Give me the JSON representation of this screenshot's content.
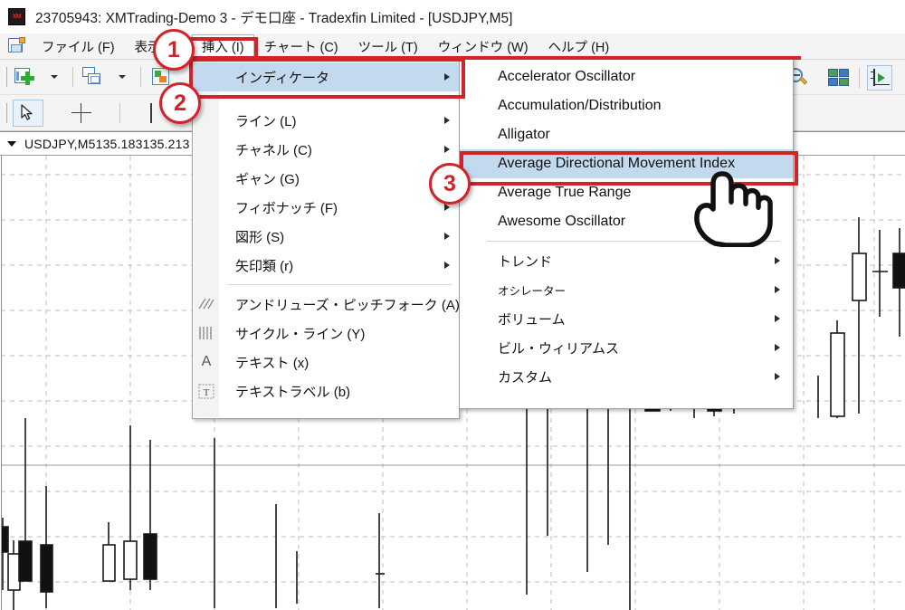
{
  "window": {
    "logo_text": "XM",
    "title": "23705943: XMTrading-Demo 3 - デモ口座 - Tradexfin Limited - [USDJPY,M5]"
  },
  "menubar": {
    "app_icon": "chart-document-icon",
    "items": [
      {
        "label": "ファイル (F)",
        "active": false
      },
      {
        "label": "表示 (V)",
        "active": false
      },
      {
        "label": "挿入 (I)",
        "active": true
      },
      {
        "label": "チャート (C)",
        "active": false
      },
      {
        "label": "ツール (T)",
        "active": false
      },
      {
        "label": "ウィンドウ (W)",
        "active": false
      },
      {
        "label": "ヘルプ (H)",
        "active": false
      }
    ]
  },
  "toolbar_standard": {
    "buttons": [
      {
        "name": "new-chart-button",
        "icon": "new-chart-icon",
        "has_dropdown": true
      },
      {
        "name": "profiles-button",
        "icon": "profiles-icon",
        "has_dropdown": true
      },
      {
        "name": "indicators-button",
        "icon": "indicators-icon",
        "has_dropdown": false
      },
      {
        "name": "crosshair-target-button",
        "icon": "crosshair-target-icon",
        "has_dropdown": false
      },
      {
        "name": "zoom-out-button",
        "icon": "zoom-out-icon",
        "has_dropdown": false
      },
      {
        "name": "tile-windows-button",
        "icon": "tile-windows-icon",
        "has_dropdown": false
      },
      {
        "name": "auto-scroll-button",
        "icon": "axis-play-icon",
        "has_dropdown": false
      }
    ]
  },
  "toolbar_line_studies": {
    "buttons": [
      {
        "name": "cursor-button",
        "icon": "arrow-cursor-icon",
        "pressed": true
      },
      {
        "name": "crosshair-button",
        "icon": "crosshair-icon",
        "pressed": false
      },
      {
        "name": "vertical-line-button",
        "icon": "vertical-line-icon",
        "pressed": false
      },
      {
        "name": "horizontal-line-button",
        "icon": "horizontal-line-icon",
        "pressed": false
      }
    ]
  },
  "chart": {
    "symbol_label": "USDJPY,M5",
    "bid": "135.183",
    "ask": "135.213",
    "chart_data": {
      "type": "candlestick",
      "symbol": "USDJPY",
      "timeframe": "M5",
      "bid": 135.183,
      "ask": 135.213,
      "grid": true
    }
  },
  "insert_menu": {
    "items": [
      {
        "label": "インディケータ",
        "submenu": true,
        "selected": true,
        "icon": ""
      },
      {
        "label": "ライン (L)",
        "submenu": true,
        "selected": false,
        "icon": ""
      },
      {
        "label": "チャネル (C)",
        "submenu": true,
        "selected": false,
        "icon": ""
      },
      {
        "label": "ギャン (G)",
        "submenu": true,
        "selected": false,
        "icon": ""
      },
      {
        "label": "フィボナッチ (F)",
        "submenu": true,
        "selected": false,
        "icon": ""
      },
      {
        "label": "図形 (S)",
        "submenu": true,
        "selected": false,
        "icon": ""
      },
      {
        "label": "矢印類 (r)",
        "submenu": true,
        "selected": false,
        "icon": ""
      },
      {
        "label": "アンドリューズ・ピッチフォーク (A)",
        "submenu": false,
        "selected": false,
        "icon": "pitchfork-icon"
      },
      {
        "label": "サイクル・ライン (Y)",
        "submenu": false,
        "selected": false,
        "icon": "cycle-lines-icon"
      },
      {
        "label": "テキスト (x)",
        "submenu": false,
        "selected": false,
        "icon": "text-icon"
      },
      {
        "label": "テキストラベル (b)",
        "submenu": false,
        "selected": false,
        "icon": "text-label-icon"
      }
    ]
  },
  "indicator_submenu": {
    "items": [
      {
        "label": "Accelerator Oscillator",
        "submenu": false,
        "selected": false
      },
      {
        "label": "Accumulation/Distribution",
        "submenu": false,
        "selected": false
      },
      {
        "label": "Alligator",
        "submenu": false,
        "selected": false
      },
      {
        "label": "Average Directional Movement Index",
        "submenu": false,
        "selected": true
      },
      {
        "label": "Average True Range",
        "submenu": false,
        "selected": false
      },
      {
        "label": "Awesome Oscillator",
        "submenu": false,
        "selected": false
      }
    ],
    "category_items": [
      {
        "label": "トレンド",
        "submenu": true,
        "selected": false
      },
      {
        "label": "オシレーター",
        "submenu": true,
        "selected": false
      },
      {
        "label": "ボリューム",
        "submenu": true,
        "selected": false
      },
      {
        "label": "ビル・ウィリアムス",
        "submenu": true,
        "selected": false
      },
      {
        "label": "カスタム",
        "submenu": true,
        "selected": false
      }
    ]
  },
  "annotations": {
    "accent_color": "#d2232a",
    "steps": [
      {
        "number": "1",
        "target": "insert-menu"
      },
      {
        "number": "2",
        "target": "indicator-menu-item"
      },
      {
        "number": "3",
        "target": "average-directional-movement-index-item"
      }
    ],
    "cursor": "pointing-hand-cursor"
  }
}
